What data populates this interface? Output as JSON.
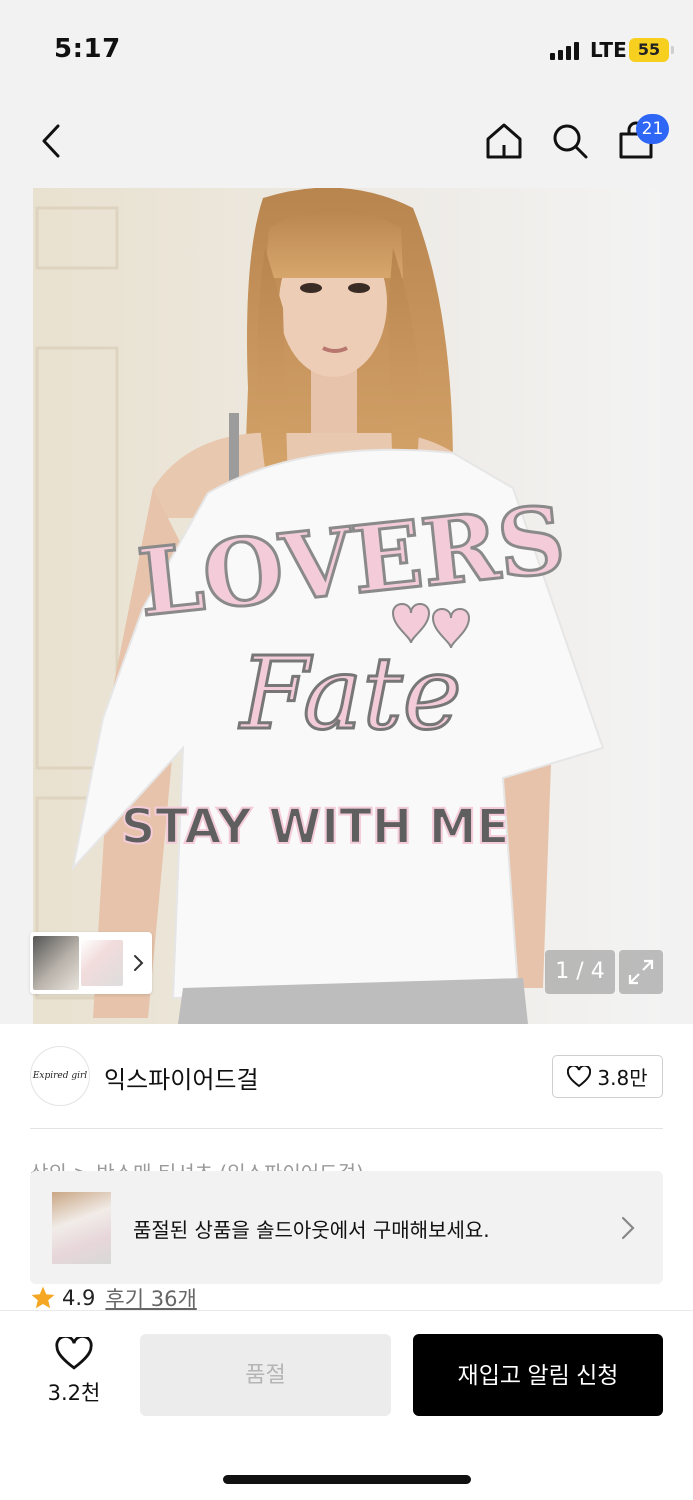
{
  "status_bar": {
    "time": "5:17",
    "network": "LTE",
    "battery": "55"
  },
  "nav": {
    "cart_badge": "21"
  },
  "gallery": {
    "counter": "1 / 4"
  },
  "brand": {
    "logo_text": "Expired girl",
    "name": "익스파이어드걸",
    "likes": "3.8만"
  },
  "breadcrumb": "상의 > 반소매 티셔츠 (익스파이어드걸)",
  "soldout_banner": {
    "text": "품절된 상품을 솔드아웃에서 구매해보세요."
  },
  "rating": {
    "score": "4.9",
    "reviews": "후기 36개"
  },
  "bottom_bar": {
    "wish_count": "3.2천",
    "soldout_label": "품절",
    "restock_label": "재입고 알림 신청"
  },
  "colors": {
    "badge": "#2e66f6",
    "star": "#f5a623",
    "primary_button": "#000000"
  },
  "product_image": {
    "shirt_text_top": "LOVERS",
    "shirt_text_middle": "Fate",
    "shirt_text_bottom": "STAY WITH ME"
  }
}
